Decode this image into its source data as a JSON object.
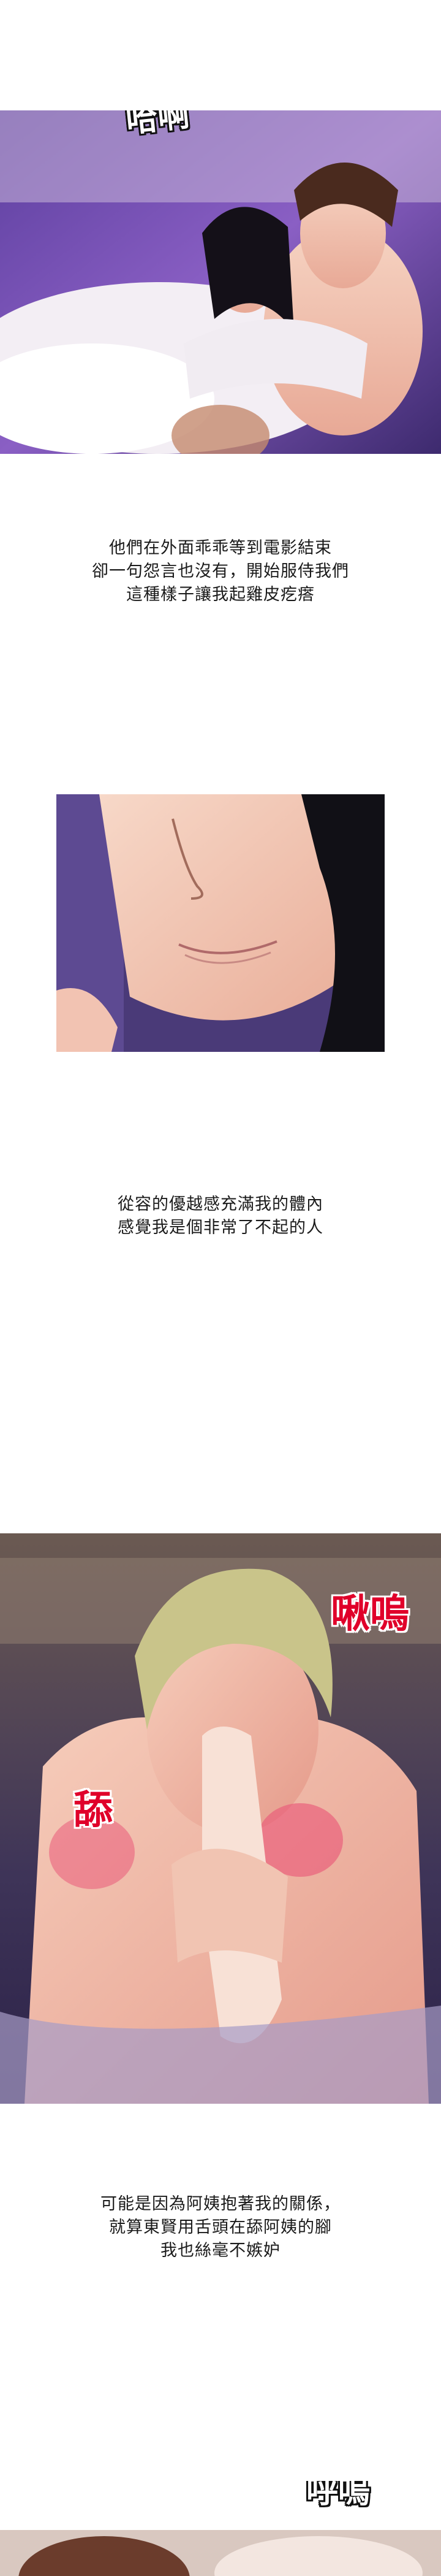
{
  "panels": {
    "panel1": {
      "sfx": "哈啊"
    },
    "caption1": {
      "lines": [
        "他們在外面乖乖等到電影結束",
        "卻一句怨言也沒有，開始服侍我們",
        "這種樣子讓我起雞皮疙瘩"
      ]
    },
    "caption2": {
      "lines": [
        "從容的優越感充滿我的體內",
        "感覺我是個非常了不起的人"
      ]
    },
    "panel3": {
      "sfx_top": "啾嗚",
      "sfx_side": "舔"
    },
    "caption3": {
      "lines": [
        "可能是因為阿姨抱著我的關係，",
        "就算東賢用舌頭在舔阿姨的腳",
        "我也絲毫不嫉妒"
      ]
    },
    "panel4": {
      "sfx": "呼嗚"
    }
  },
  "colors": {
    "sfx_red": "#e0002a",
    "bed_purple": "#6a4fb0",
    "skin": "#f2c7b4"
  }
}
